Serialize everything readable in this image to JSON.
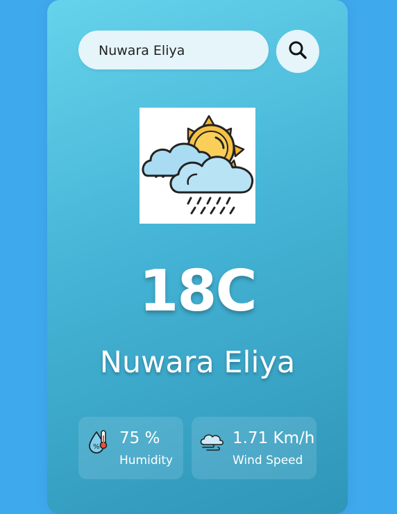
{
  "search": {
    "value": "Nuwara Eliya",
    "button_icon": "search-icon"
  },
  "weather": {
    "icon": "sun-cloud-rain-icon",
    "temperature": "18C",
    "city": "Nuwara Eliya"
  },
  "details": {
    "humidity": {
      "value": "75 %",
      "label": "Humidity",
      "icon": "humidity-icon"
    },
    "wind": {
      "value": "1.71 Km/h",
      "label": "Wind Speed",
      "icon": "wind-icon"
    }
  },
  "colors": {
    "page_background": "#3fa9ee",
    "card_gradient_top": "#66d3eb",
    "card_gradient_bottom": "#2f96b8",
    "search_background": "#e5f5fa"
  }
}
